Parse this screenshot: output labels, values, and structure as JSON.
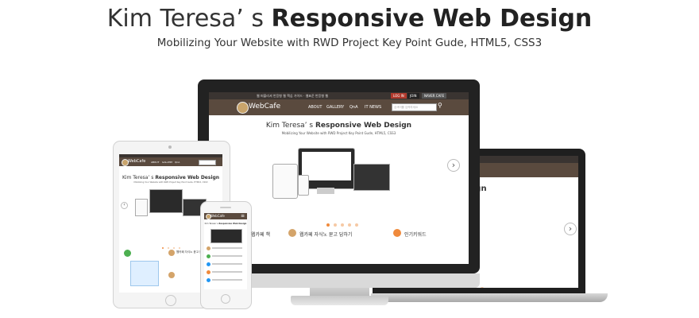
{
  "hero": {
    "title_prefix": "Kim Teresa’ s ",
    "title_bold": "Responsive Web Design",
    "subtitle": "Mobilizing Your Website with RWD Project Key Point Gude, HTML5, CSS3"
  },
  "site": {
    "topbar_notice": "웹 퍼블리셔 반응형 웹 핵심 가이드 · 웹표준 반응형 웹",
    "login": "LOG IN",
    "join": "JOIN",
    "naver_cafe": "NAVER CAFE",
    "logo": "WebCafe",
    "nav": [
      "ABOUT",
      "GALLERY",
      "QnA",
      "IT NEWS"
    ],
    "search_placeholder": "검색어를 입력하세요",
    "hero_title_prefix": "Kim Teresa’ s ",
    "hero_title_bold": "Responsive Web Design",
    "hero_subtitle": "Mobilizing Your Website with RWD Project Key Point Gude, HTML5, CSS3",
    "section_1": "웹카페 자식노 묻고 답하기",
    "section_2": "인기키워드",
    "section_short": "웹카페 책",
    "next_arrow": "›",
    "prev_arrow": "‹"
  },
  "colors": {
    "topbar": "#3a3431",
    "nav": "#5a4a3e",
    "accent": "#f08a3c",
    "login_red": "#b0392c"
  }
}
